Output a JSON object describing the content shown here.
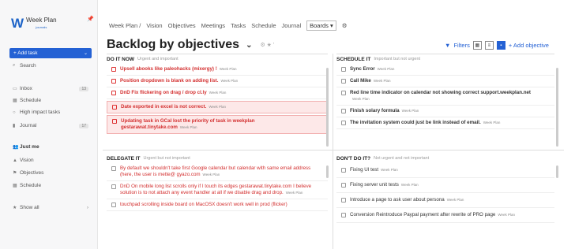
{
  "app": {
    "logo_name": "Week Plan",
    "logo_sub": "journals"
  },
  "sidebar": {
    "add_task": "+ Add task",
    "search": "Search",
    "items": [
      {
        "label": "Inbox",
        "badge": "13"
      },
      {
        "label": "Schedule",
        "badge": ""
      },
      {
        "label": "High impact tasks",
        "badge": ""
      },
      {
        "label": "Journal",
        "badge": "17"
      },
      {
        "label": "Just me",
        "badge": ""
      },
      {
        "label": "Vision",
        "badge": ""
      },
      {
        "label": "Objectives",
        "badge": ""
      },
      {
        "label": "Schedule",
        "badge": ""
      },
      {
        "label": "Show all",
        "badge": ""
      }
    ]
  },
  "nav": {
    "items": [
      "Week Plan /",
      "Vision",
      "Objectives",
      "Meetings",
      "Tasks",
      "Schedule",
      "Journal"
    ],
    "active": "Boards ▾"
  },
  "page": {
    "title": "Backlog by objectives"
  },
  "toolbar": {
    "filters": "Filters",
    "add_objective": "+ Add objective"
  },
  "quadrants": {
    "do_it_now": {
      "title": "DO IT NOW",
      "subtitle": "Urgent and important",
      "tasks": [
        {
          "text": "Upsell abooks like paleohacks (mixergy) !",
          "tag": "Week Plan"
        },
        {
          "text": "Position dropdown is blank on adding list.",
          "tag": "Week Plan"
        },
        {
          "text": "DnD  Fix flickering on drag / drop  cl.ly",
          "tag": "Week Plan"
        },
        {
          "text": "Date exported in excel is not correct.",
          "tag": "Week Plan"
        },
        {
          "text": "Updating task in GCal lost the priority of task in weekplan  gestarawat.tinytake.com",
          "tag": "Week Plan"
        }
      ]
    },
    "schedule_it": {
      "title": "SCHEDULE IT",
      "subtitle": "Important but not urgent",
      "tasks": [
        {
          "text": "Sync Error",
          "tag": "Week Plan"
        },
        {
          "text": "Call Mike",
          "tag": "Week Plan"
        },
        {
          "text": "Red line time indicator on calendar not showing correct  support.weekplan.net",
          "tag": "Week Plan"
        },
        {
          "text": "Finish solary formula",
          "tag": "Week Plan"
        },
        {
          "text": "The invitation system could just be link instead of email.",
          "tag": "Week Plan"
        }
      ]
    },
    "delegate_it": {
      "title": "DELEGATE IT",
      "subtitle": "Urgent but not important",
      "tasks": [
        {
          "text": "By default we shouldn't take first Google calendar but calendar with same email address (here, the user is mette@  gyazo.com",
          "tag": "Week Plan"
        },
        {
          "text": "DnD  On mobile long list scrolls only if I touch its edges  gestarawat.tinytake.com I believe solution is to not attach any event handler at all if we disable drag and drop.",
          "tag": "Week Plan"
        },
        {
          "text": "touchpad scrolling inside board on MacOSX doesn't work well in prod (flicker)",
          "tag": ""
        }
      ]
    },
    "dont_do_it": {
      "title": "DON'T DO IT?",
      "subtitle": "Not urgent and not important",
      "tasks": [
        {
          "text": "Fixing UI test",
          "tag": "Week Plan"
        },
        {
          "text": "Fixing server unit tests",
          "tag": "Week Plan"
        },
        {
          "text": "Introduce a page to ask user about persona",
          "tag": "Week Plan"
        },
        {
          "text": "Conversion  Reintroduce Paypal payment after rewrite of PRO page",
          "tag": "Week Plan"
        }
      ]
    }
  }
}
